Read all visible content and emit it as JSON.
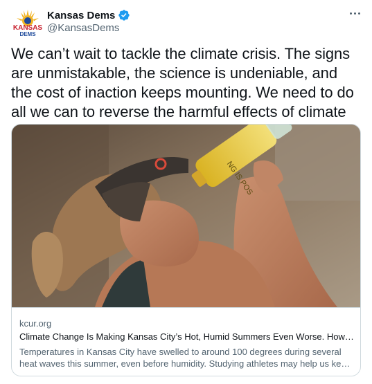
{
  "author": {
    "display_name": "Kansas Dems",
    "handle": "@KansasDems",
    "verified": true,
    "avatar_text_top": "KANSAS",
    "avatar_text_bottom": "DEMS"
  },
  "tweet": {
    "text": "We can’t wait to tackle the climate crisis. The signs are unmistakable, the science is undeniable, and the cost of inaction keeps mounting. We need to do all we can to reverse the harmful effects of climate change."
  },
  "card": {
    "domain": "kcur.org",
    "title": "Climate Change Is Making Kansas City’s Hot, Humid Summers Even Worse. How Can We Keep Cool?",
    "description_line1": "Temperatures in Kansas City have swelled to around 100 degrees during several",
    "description_line2": "heat waves this summer, even before humidity. Studying athletes may help us keep cool.",
    "image_description_bottle_text": "NG IS POS"
  },
  "colors": {
    "text_primary": "#0f1419",
    "text_secondary": "#536471",
    "border": "#cfd9de",
    "verified_blue": "#1d9bf0",
    "brand_red": "#c8202e",
    "brand_blue": "#1e4a9b",
    "sun_gold": "#f2b424"
  },
  "icons": {
    "verified": "verified-badge-icon",
    "more": "more-options-icon"
  }
}
